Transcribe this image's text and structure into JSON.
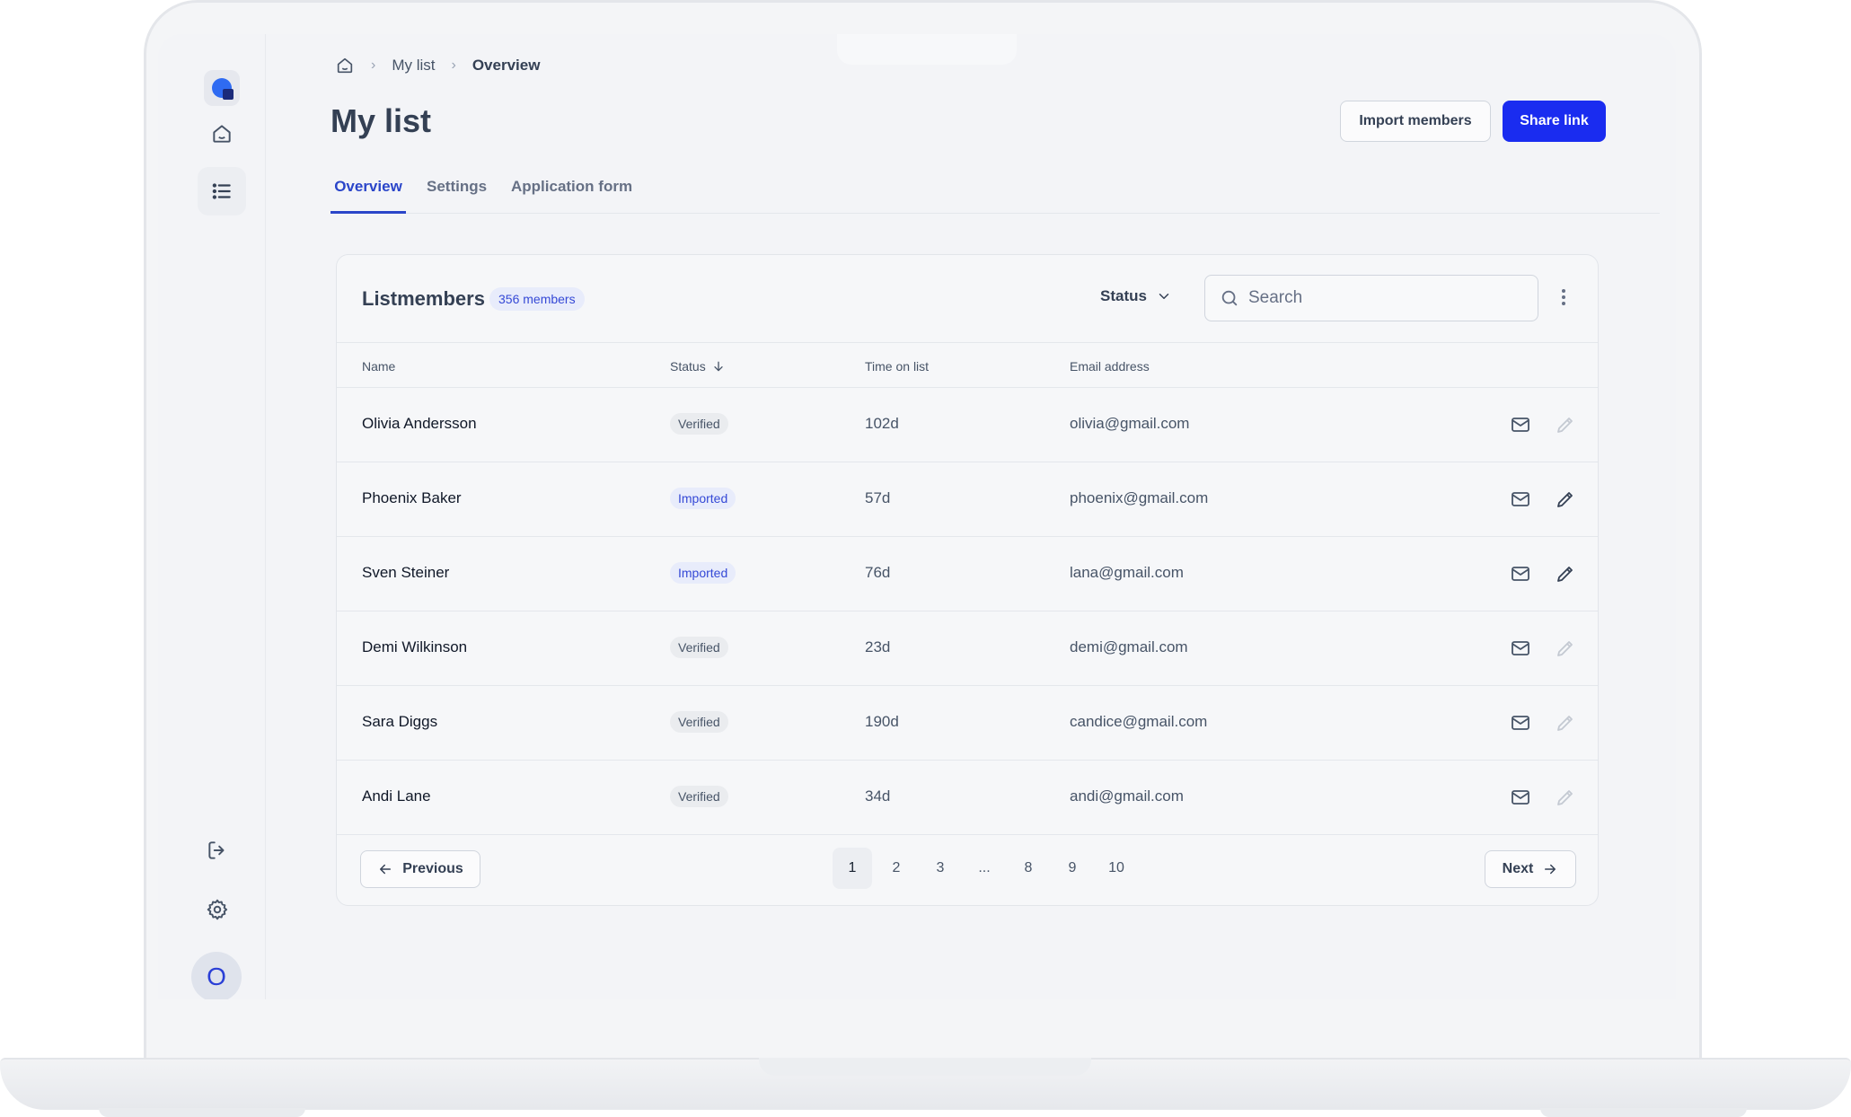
{
  "breadcrumb": {
    "item1": "My list",
    "item2": "Overview"
  },
  "page": {
    "title": "My list"
  },
  "header_buttons": {
    "import": "Import members",
    "share": "Share link"
  },
  "tabs": [
    {
      "label": "Overview"
    },
    {
      "label": "Settings"
    },
    {
      "label": "Application form"
    }
  ],
  "card": {
    "title": "Listmembers",
    "count": "356 members",
    "status_filter": "Status",
    "search_placeholder": "Search"
  },
  "columns": {
    "name": "Name",
    "status": "Status",
    "time": "Time on list",
    "email": "Email address"
  },
  "rows": [
    {
      "name": "Olivia Andersson",
      "status": "Verified",
      "time": "102d",
      "email": "olivia@gmail.com"
    },
    {
      "name": "Phoenix Baker",
      "status": "Imported",
      "time": "57d",
      "email": "phoenix@gmail.com"
    },
    {
      "name": "Sven Steiner",
      "status": "Imported",
      "time": "76d",
      "email": "lana@gmail.com"
    },
    {
      "name": "Demi Wilkinson",
      "status": "Verified",
      "time": "23d",
      "email": "demi@gmail.com"
    },
    {
      "name": "Sara Diggs",
      "status": "Verified",
      "time": "190d",
      "email": "candice@gmail.com"
    },
    {
      "name": "Andi Lane",
      "status": "Verified",
      "time": "34d",
      "email": "andi@gmail.com"
    }
  ],
  "pagination": {
    "previous": "Previous",
    "next": "Next",
    "pages": [
      "1",
      "2",
      "3",
      "...",
      "8",
      "9",
      "10"
    ],
    "current": "1"
  },
  "user": {
    "avatar_initial": "O"
  },
  "colors": {
    "primary": "#1a2cf0",
    "accent_text": "#2a45c9",
    "imported_badge_bg": "#e8ecfb"
  },
  "icons": [
    "logo-icon",
    "home-icon",
    "list-icon",
    "logout-icon",
    "settings-icon",
    "search-icon",
    "chevron-down-icon",
    "kebab-icon",
    "arrow-down-icon",
    "mail-icon",
    "edit-icon",
    "arrow-left-icon",
    "arrow-right-icon"
  ]
}
